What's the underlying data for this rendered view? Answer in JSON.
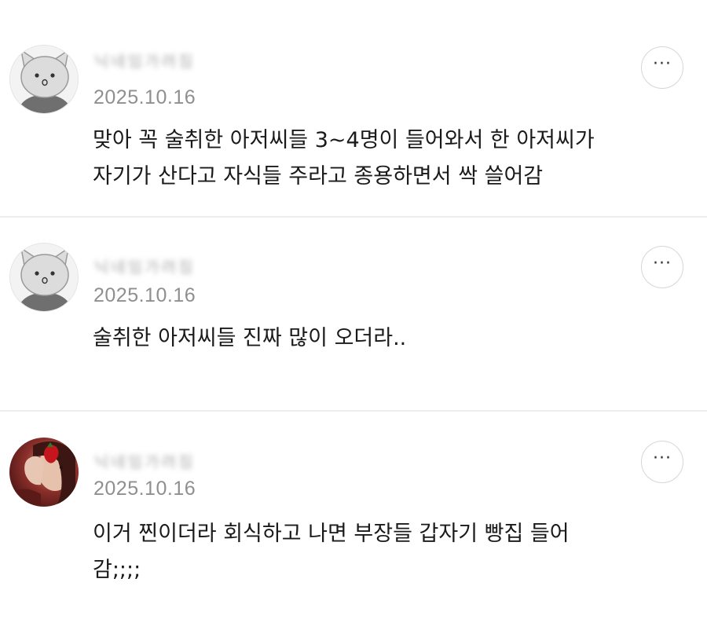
{
  "comments": [
    {
      "author": "닉네임가려짐",
      "avatar": "cat-avatar",
      "date": "2025.10.16",
      "text": "맞아 꼭 술취한 아저씨들 3~4명이 들어와서 한 아저씨가\n자기가 산다고 자식들 주라고 종용하면서 싹 쓸어감",
      "more_icon": "···"
    },
    {
      "author": "닉네임가려짐",
      "avatar": "cat-avatar",
      "date": "2025.10.16",
      "text": "술취한 아저씨들 진짜 많이 오더라..",
      "more_icon": "···"
    },
    {
      "author": "닉네임가려짐",
      "avatar": "photo-avatar",
      "date": "2025.10.16",
      "text": "이거 찐이더라 회식하고 나면 부장들 갑자기 빵집 들어\n감;;;;",
      "more_icon": "···"
    }
  ],
  "colors": {
    "date": "#8f8f8f",
    "text": "#1a1a1a",
    "divider": "#ececec",
    "button_border": "#d6d6d6"
  }
}
